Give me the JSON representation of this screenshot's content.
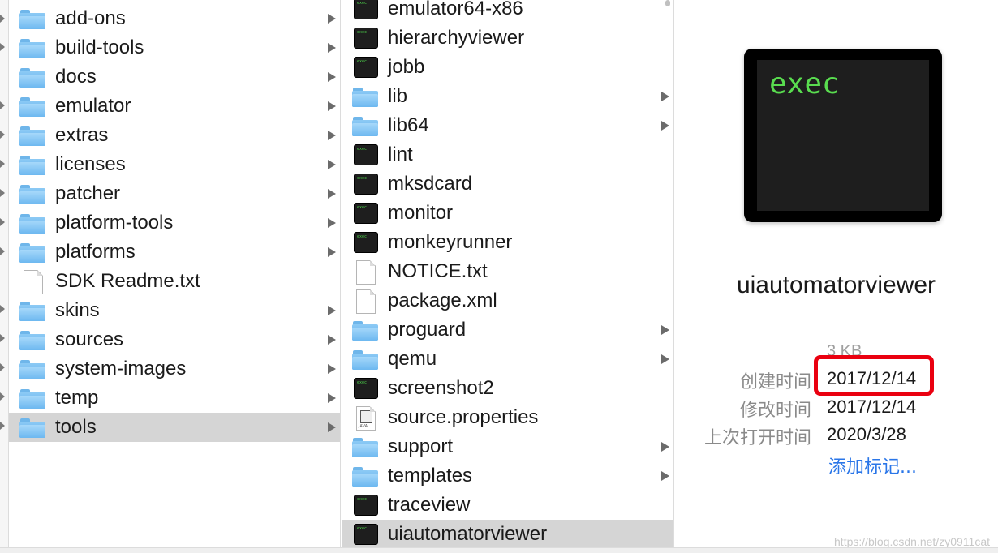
{
  "column1": {
    "items": [
      {
        "name": "add-ons",
        "type": "folder",
        "has_children": true
      },
      {
        "name": "build-tools",
        "type": "folder",
        "has_children": true
      },
      {
        "name": "docs",
        "type": "folder",
        "has_children": true
      },
      {
        "name": "emulator",
        "type": "folder",
        "has_children": true
      },
      {
        "name": "extras",
        "type": "folder",
        "has_children": true
      },
      {
        "name": "licenses",
        "type": "folder",
        "has_children": true
      },
      {
        "name": "patcher",
        "type": "folder",
        "has_children": true
      },
      {
        "name": "platform-tools",
        "type": "folder",
        "has_children": true
      },
      {
        "name": "platforms",
        "type": "folder",
        "has_children": true
      },
      {
        "name": "SDK Readme.txt",
        "type": "document",
        "has_children": false
      },
      {
        "name": "skins",
        "type": "folder",
        "has_children": true
      },
      {
        "name": "sources",
        "type": "folder",
        "has_children": true
      },
      {
        "name": "system-images",
        "type": "folder",
        "has_children": true
      },
      {
        "name": "temp",
        "type": "folder",
        "has_children": true
      },
      {
        "name": "tools",
        "type": "folder",
        "has_children": true,
        "selected": true
      }
    ]
  },
  "column2": {
    "items": [
      {
        "name": "emulator64-x86",
        "type": "exec",
        "has_children": false
      },
      {
        "name": "hierarchyviewer",
        "type": "exec",
        "has_children": false
      },
      {
        "name": "jobb",
        "type": "exec",
        "has_children": false
      },
      {
        "name": "lib",
        "type": "folder",
        "has_children": true
      },
      {
        "name": "lib64",
        "type": "folder",
        "has_children": true
      },
      {
        "name": "lint",
        "type": "exec",
        "has_children": false
      },
      {
        "name": "mksdcard",
        "type": "exec",
        "has_children": false
      },
      {
        "name": "monitor",
        "type": "exec",
        "has_children": false
      },
      {
        "name": "monkeyrunner",
        "type": "exec",
        "has_children": false
      },
      {
        "name": "NOTICE.txt",
        "type": "document",
        "has_children": false
      },
      {
        "name": "package.xml",
        "type": "document",
        "has_children": false
      },
      {
        "name": "proguard",
        "type": "folder",
        "has_children": true
      },
      {
        "name": "qemu",
        "type": "folder",
        "has_children": true
      },
      {
        "name": "screenshot2",
        "type": "exec",
        "has_children": false
      },
      {
        "name": "source.properties",
        "type": "java",
        "has_children": false
      },
      {
        "name": "support",
        "type": "folder",
        "has_children": true
      },
      {
        "name": "templates",
        "type": "folder",
        "has_children": true
      },
      {
        "name": "traceview",
        "type": "exec",
        "has_children": false
      },
      {
        "name": "uiautomatorviewer",
        "type": "exec",
        "has_children": false,
        "selected": true
      }
    ]
  },
  "preview": {
    "icon_text": "exec",
    "file_name": "uiautomatorviewer",
    "size": "3 KB",
    "created_label": "创建时间",
    "created_value": "2017/12/14",
    "modified_label": "修改时间",
    "modified_value": "2017/12/14",
    "opened_label": "上次打开时间",
    "opened_value": "2020/3/28",
    "add_tags": "添加标记..."
  },
  "watermark": "https://blog.csdn.net/zy0911cat",
  "icons": {
    "folder": "folder-icon",
    "exec": "exec-icon",
    "document": "document-icon",
    "java": "java-file-icon",
    "chevron": "chevron-right-icon"
  },
  "colors": {
    "folder": "#6db8f0",
    "selection": "#d5d5d5",
    "highlight": "#ea0010",
    "link": "#2a76e8",
    "exec_text": "#59dc4f"
  }
}
